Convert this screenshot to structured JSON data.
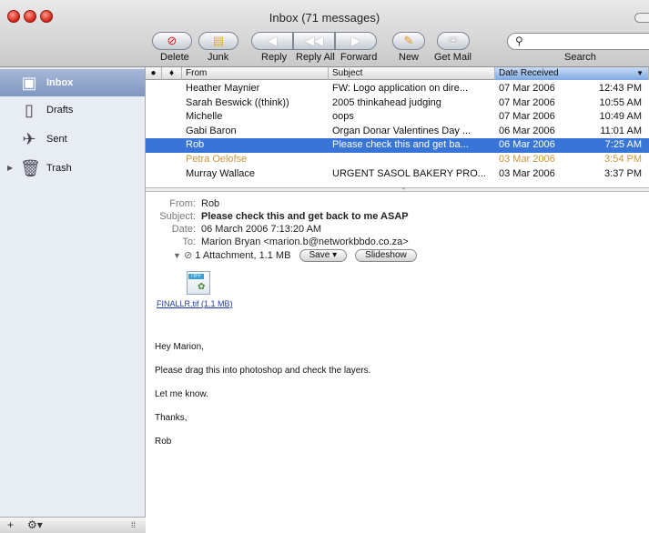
{
  "window": {
    "title": "Inbox (71 messages)"
  },
  "toolbar": {
    "buttons": [
      {
        "label": "Delete",
        "icon": "delete-icon"
      },
      {
        "label": "Junk",
        "icon": "junk-icon"
      },
      {
        "label": "Reply",
        "icon": "reply-icon"
      },
      {
        "label": "Reply All",
        "icon": "reply-all-icon"
      },
      {
        "label": "Forward",
        "icon": "forward-icon"
      },
      {
        "label": "New",
        "icon": "new-message-icon"
      },
      {
        "label": "Get Mail",
        "icon": "get-mail-icon"
      }
    ],
    "search_label": "Search",
    "search_value": ""
  },
  "sidebar": {
    "items": [
      {
        "label": "Inbox",
        "icon": "inbox-icon",
        "selected": true
      },
      {
        "label": "Drafts",
        "icon": "drafts-icon"
      },
      {
        "label": "Sent",
        "icon": "sent-icon"
      },
      {
        "label": "Trash",
        "icon": "trash-icon"
      }
    ],
    "footer": {
      "add": "+",
      "actions": "⚙▾",
      "grip": "⁞⁞"
    }
  },
  "message_list": {
    "columns": {
      "from": "From",
      "subject": "Subject",
      "date": "Date Received"
    },
    "rows": [
      {
        "from": "Heather Maynier",
        "subject": "FW: Logo application on dire...",
        "date": "07 Mar 2006",
        "time": "12:43 PM"
      },
      {
        "from": "Sarah Beswick ((think))",
        "subject": "2005 thinkahead judging",
        "date": "07 Mar 2006",
        "time": "10:55 AM"
      },
      {
        "from": "Michelle",
        "subject": "oops",
        "date": "07 Mar 2006",
        "time": "10:49 AM"
      },
      {
        "from": "Gabi Baron",
        "subject": "Organ Donar Valentines Day ...",
        "date": "06 Mar 2006",
        "time": "11:01 AM"
      },
      {
        "from": "Rob",
        "subject": "Please check this and get ba...",
        "date": "06 Mar 2006",
        "time": "7:25 AM",
        "selected": true
      },
      {
        "from": "Petra Oelofse",
        "subject": "",
        "date": "03 Mar 2006",
        "time": "3:54 PM",
        "muted": true
      },
      {
        "from": "Murray Wallace",
        "subject": "URGENT SASOL BAKERY PRO...",
        "date": "03 Mar 2006",
        "time": "3:37 PM"
      }
    ]
  },
  "preview": {
    "from_label": "From:",
    "from": "Rob",
    "subject_label": "Subject:",
    "subject": "Please check this and get back to me ASAP",
    "date_label": "Date:",
    "date": "06 March 2006 7:13:20 AM",
    "to_label": "To:",
    "to": "Marion Bryan <marion.b@networkbbdo.co.za>",
    "attachment_summary": "1 Attachment, 1.1 MB",
    "save_label": "Save ▾",
    "slideshow_label": "Slideshow",
    "file_tag": "TIFF",
    "attachment_link": "FINALLR.tif (1.1 MB)",
    "body": [
      "Hey Marion,",
      "Please drag this into photoshop and check the layers.",
      "Let me know.",
      "Thanks,",
      "Rob"
    ]
  }
}
